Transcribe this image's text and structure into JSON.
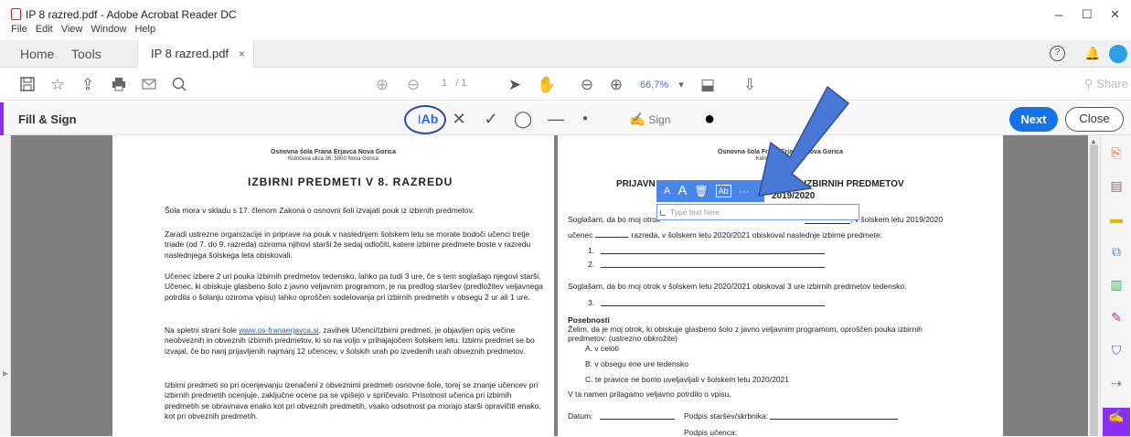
{
  "window": {
    "title": "IP 8 razred.pdf - Adobe Acrobat Reader DC",
    "menu": [
      "File",
      "Edit",
      "View",
      "Window",
      "Help"
    ],
    "controls": [
      "–",
      "☐",
      "✕"
    ]
  },
  "tabs": {
    "home": "Home",
    "tools": "Tools",
    "document": "IP 8 razred.pdf",
    "close": "×"
  },
  "toolbar": {
    "page_current": "1",
    "page_total": "/ 1",
    "zoom": "66,7%",
    "zoom_caret": "▾",
    "share": "Share"
  },
  "fill_sign": {
    "label": "Fill & Sign",
    "text_tool": "Ab",
    "sign": "Sign",
    "next": "Next",
    "close": "Close"
  },
  "page_left": {
    "school": "Osnovna šola Frana Erjavca Nova Gorica",
    "address": "Kidričeva ulica 36, 5000 Nova Gorica",
    "heading": "IZBIRNI PREDMETI V 8. RAZREDU",
    "p1": "Šola mora v skladu s 17. členom Zakona o osnovni šoli izvajati pouk iz izbirnih predmetov.",
    "p2": "Zaradi ustrezne organizacije in priprave na pouk v naslednjem šolskem letu se morate bodoči učenci tretje triade (od 7. do 9. razreda) oziroma njihovi starši že sedaj odločiti, katere izbirne predmete boste v razredu naslednjega šolskega leta obiskovali.",
    "p3": "Učenec izbere 2 uri pouka izbirnih predmetov tedensko, lahko pa tudi 3 ure, če s tem soglašajo njegovi starši. Učenec, ki obiskuje glasbeno šolo z javno veljavnim programom, je na predlog staršev (predložitev veljavnega potrdila o šolanju oziroma vpisu) lahko oproščen sodelovanja pri izbirnih predmetih v obsegu 2 ur ali 1 ure.",
    "p4_before": "Na spletni strani šole ",
    "p4_link": "www.os-franaerjavca.si",
    "p4_after": ", zavihek Učenci/Izbirni predmeti, je objavljen opis večine neobveznih in obveznih izbirnih predmetov, ki so na voljo v prihajajočem šolskem letu. Izbirni predmet se bo izvajal, če bo nanj prijavljenih najmanj 12 učencev, v šolskih urah po izvedenih urah obveznih predmetov.",
    "p5": "Izbirni predmeti so pri ocenjevanju izenačeni z obveznimi predmeti osnovne šole, torej se znanje učencev pri izbirnih predmetih ocenjuje, zaključne ocene pa se vpišejo v spričevalo. Prisotnost učenca pri izbirnih predmetih se obravnava enako kot pri obveznih predmetih, vsako odsotnost pa morajo starši opravičiti enako, kot pri obveznih predmetih."
  },
  "page_right": {
    "school": "Osnovna šola Frana Erjavca Nova Gorica",
    "address": "Kidričeva ulica 36, 5",
    "heading_left": "PRIJAVN",
    "heading_right": "VANJE IZBIRNIH PREDMETOV",
    "heading_year": "2019/2020",
    "l1_before": "Soglašam, da bo moj otrok",
    "l1_after": ", v šolskem letu 2019/2020",
    "l2_a": "učenec",
    "l2_b": "razreda, v šolskem letu 2020/2021 obiskoval naslednje izbirne predmete:",
    "item1": "1.",
    "item2": "2.",
    "l3": "Soglašam, da bo moj otrok v šolskem letu 2020/2021 obiskoval 3 ure izbirnih predmetov tedensko:",
    "item3": "3.",
    "posebnosti": "Posebnosti",
    "pos1": "Želim, da je moj otrok, ki obiskuje glasbeno šolo z javno veljavnim programom, oproščen pouka izbirnih",
    "pos2": "predmetov: (ustrezno obkrožite)",
    "optA": "A.  v celoti",
    "optB": "B.  v obsegu ene ure tedensko",
    "optC": "C.  te pravice ne bomo uveljavljali v šolskem letu 2020/2021",
    "attach": "V ta namen prilagamo veljavno potrdilo o vpisu.",
    "datum": "Datum:",
    "podpis_starsev": "Podpis staršev/skrbnika:",
    "podpis_ucenca": "Podpis učenca:"
  },
  "field": {
    "placeholder": "Type text here",
    "toolbar": [
      "A",
      "A",
      "🗑",
      "Ab",
      "···"
    ]
  },
  "colors": {
    "accent_purple": "#8b2ef4",
    "primary_blue": "#1473e6",
    "arrow_blue": "#4a78d6",
    "canvas_gray": "#7f7f7f"
  }
}
